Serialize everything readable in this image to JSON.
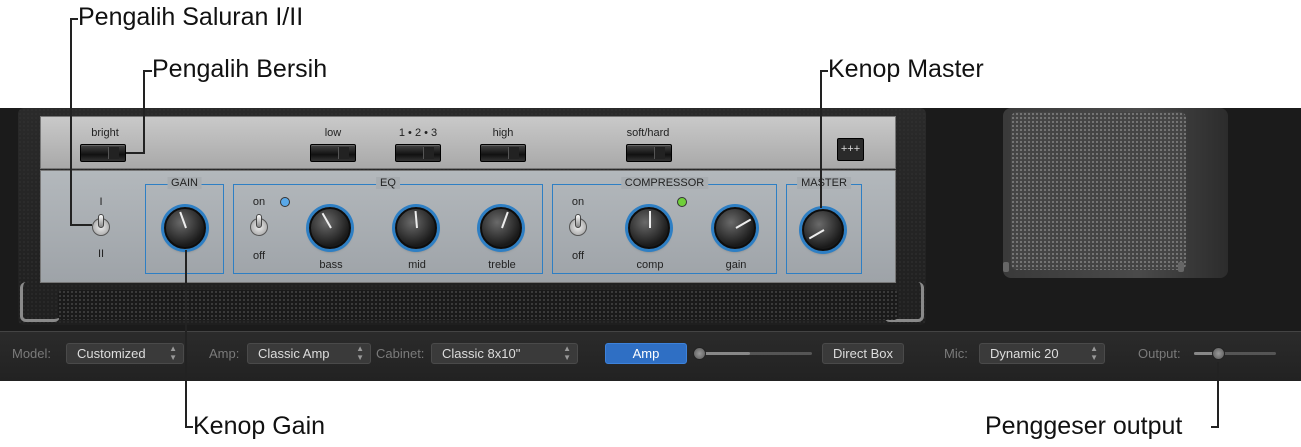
{
  "callouts": {
    "channel_switch": "Pengalih Saluran I/II",
    "clean_switch": "Pengalih Bersih",
    "master_knob": "Kenop Master",
    "gain_knob": "Kenop Gain",
    "output_slider": "Penggeser output"
  },
  "amp_panel": {
    "top_switches": {
      "bright": "bright",
      "low": "low",
      "range": "1 • 2 • 3",
      "high": "high",
      "soft_hard": "soft/hard"
    },
    "icon_button": "+++",
    "channel": {
      "i": "I",
      "ii": "II"
    },
    "gain_section": {
      "title": "GAIN"
    },
    "eq_section": {
      "title": "EQ",
      "on": "on",
      "off": "off",
      "bass": "bass",
      "mid": "mid",
      "treble": "treble"
    },
    "compressor_section": {
      "title": "COMPRESSOR",
      "on": "on",
      "off": "off",
      "comp": "comp",
      "gain": "gain"
    },
    "master_section": {
      "title": "MASTER"
    },
    "colors": {
      "accent_blue": "#2e7fc4",
      "eq_led": "#59a8e8",
      "comp_led": "#6fcf3a"
    }
  },
  "control_bar": {
    "model_label": "Model:",
    "model_value": "Customized",
    "amp_label": "Amp:",
    "amp_value": "Classic Amp",
    "cabinet_label": "Cabinet:",
    "cabinet_value": "Classic 8x10\"",
    "amp_button": "Amp",
    "direct_box_button": "Direct Box",
    "mic_label": "Mic:",
    "mic_value": "Dynamic 20",
    "output_label": "Output:"
  }
}
